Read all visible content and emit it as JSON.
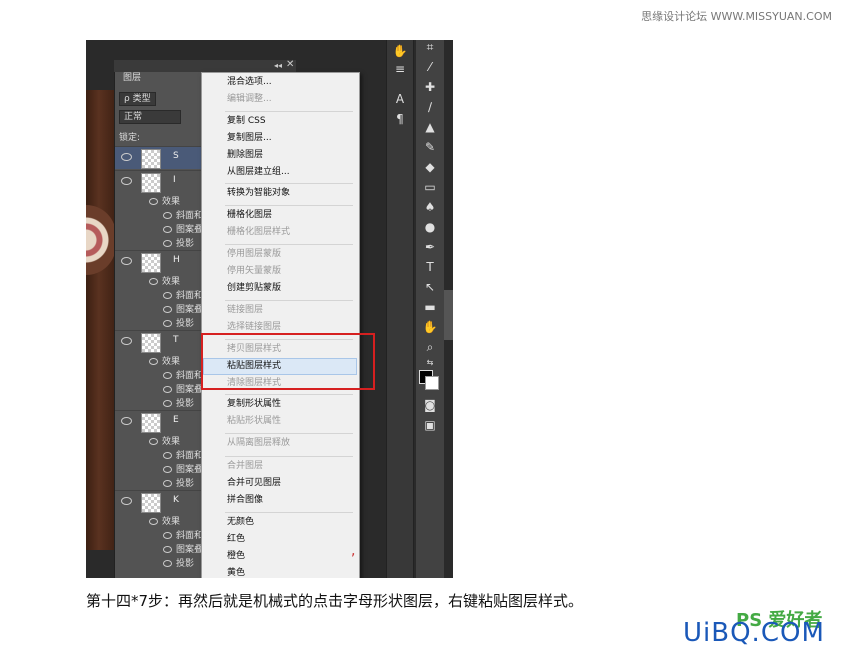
{
  "watermark_top": "思缘设计论坛 WWW.MISSYUAN.COM",
  "panel": {
    "tab_label": "图层",
    "collapse": "◂◂",
    "close": "✕",
    "filter_label": "ρ 类型",
    "blend_mode": "正常",
    "lock_label": "锁定:"
  },
  "layers": [
    {
      "name": "S"
    },
    {
      "name": "I"
    },
    {
      "name": "H"
    },
    {
      "name": "T"
    },
    {
      "name": "E"
    },
    {
      "name": "K"
    }
  ],
  "effects": {
    "label": "效果",
    "items": [
      "斜面和",
      "图案叠",
      "投影"
    ]
  },
  "menu": {
    "items": [
      {
        "label": "混合选项...",
        "disabled": false
      },
      {
        "label": "编辑调整...",
        "disabled": true
      },
      {
        "label": "复制 CSS",
        "disabled": false
      },
      {
        "label": "复制图层...",
        "disabled": false
      },
      {
        "label": "删除图层",
        "disabled": false
      },
      {
        "label": "从图层建立组...",
        "disabled": false
      },
      {
        "label": "转换为智能对象",
        "disabled": false
      },
      {
        "label": "栅格化图层",
        "disabled": false
      },
      {
        "label": "栅格化图层样式",
        "disabled": true
      },
      {
        "label": "停用图层蒙版",
        "disabled": true
      },
      {
        "label": "停用矢量蒙版",
        "disabled": true
      },
      {
        "label": "创建剪贴蒙版",
        "disabled": false
      },
      {
        "label": "链接图层",
        "disabled": true
      },
      {
        "label": "选择链接图层",
        "disabled": true
      },
      {
        "label": "拷贝图层样式",
        "disabled": true
      },
      {
        "label": "粘贴图层样式",
        "disabled": false
      },
      {
        "label": "清除图层样式",
        "disabled": true
      },
      {
        "label": "复制形状属性",
        "disabled": false
      },
      {
        "label": "粘贴形状属性",
        "disabled": true
      },
      {
        "label": "从隔离图层释放",
        "disabled": true
      },
      {
        "label": "合并图层",
        "disabled": true
      },
      {
        "label": "合并可见图层",
        "disabled": false
      },
      {
        "label": "拼合图像",
        "disabled": false
      },
      {
        "label": "无颜色",
        "disabled": false
      },
      {
        "label": "红色",
        "disabled": false
      },
      {
        "label": "橙色",
        "disabled": false
      },
      {
        "label": "黄色",
        "disabled": false
      }
    ]
  },
  "caption": "第十四*7步：再然后就是机械式的点击字母形状图层，右键粘贴图层样式。",
  "logo_ps": "PS 爱好者",
  "logo_uibq": "UiBQ.COM",
  "colors": {
    "highlight_box": "#d62020",
    "menu_hover": "#dbe8f6"
  }
}
